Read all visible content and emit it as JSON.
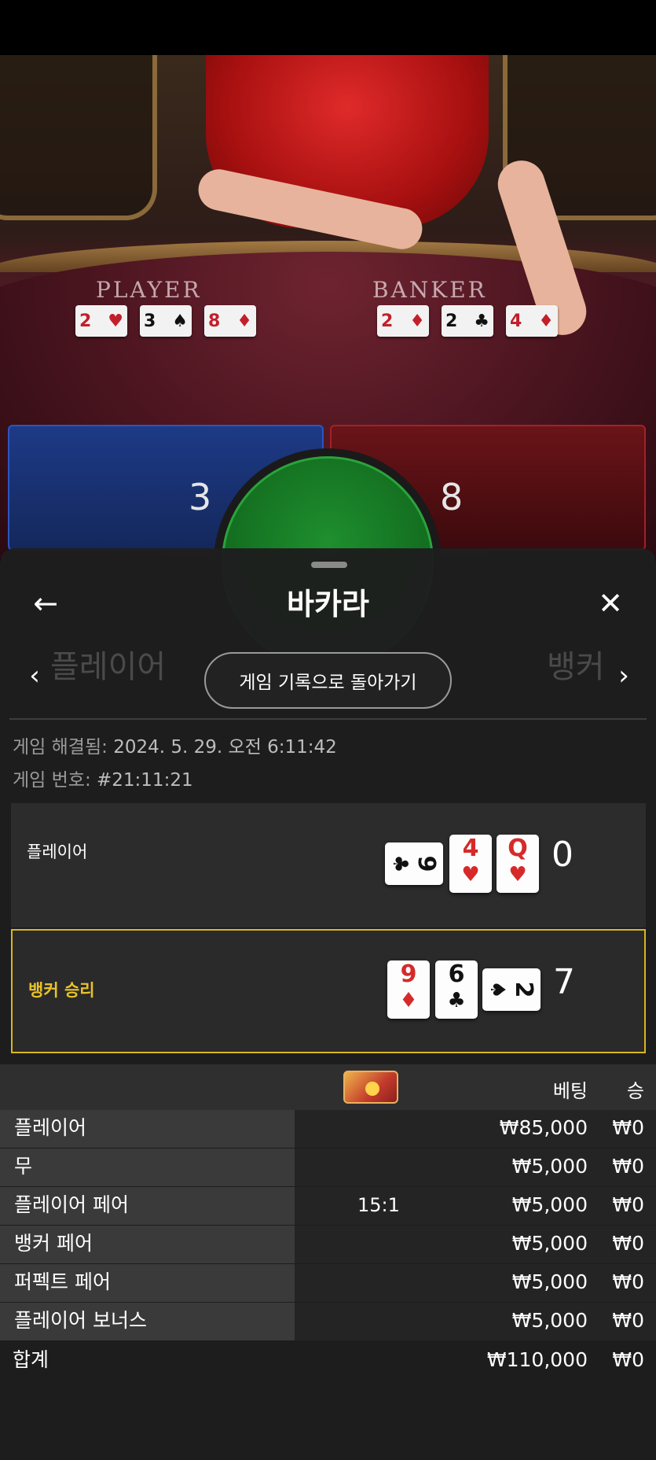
{
  "video": {
    "player_label": "PLAYER",
    "banker_label": "BANKER",
    "player_cards": [
      {
        "rank": "2",
        "suit": "♥",
        "color": "red"
      },
      {
        "rank": "3",
        "suit": "♠",
        "color": "black"
      },
      {
        "rank": "8",
        "suit": "♦",
        "color": "red"
      }
    ],
    "banker_cards": [
      {
        "rank": "2",
        "suit": "♦",
        "color": "red"
      },
      {
        "rank": "2",
        "suit": "♣",
        "color": "black"
      },
      {
        "rank": "4",
        "suit": "♦",
        "color": "red"
      }
    ]
  },
  "scores": {
    "player": "3",
    "banker": "8"
  },
  "sheet": {
    "title": "바카라",
    "back_to_history": "게임 기록으로 돌아가기",
    "resolved_label": "게임 해결됨:",
    "resolved_value": "2024. 5. 29. 오전 6:11:42",
    "game_no_label": "게임 번호:",
    "game_no_value": "#21:11:21"
  },
  "result": {
    "player": {
      "label": "플레이어",
      "total": "0",
      "cards": [
        {
          "rank": "9",
          "suit": "♣",
          "color": "black",
          "sideways": true
        },
        {
          "rank": "4",
          "suit": "♥",
          "color": "red",
          "sideways": false
        },
        {
          "rank": "Q",
          "suit": "♥",
          "color": "red",
          "sideways": false
        }
      ]
    },
    "banker": {
      "label": "뱅커 승리",
      "total": "7",
      "cards": [
        {
          "rank": "9",
          "suit": "♦",
          "color": "red",
          "sideways": false
        },
        {
          "rank": "6",
          "suit": "♣",
          "color": "black",
          "sideways": false
        },
        {
          "rank": "2",
          "suit": "♠",
          "color": "black",
          "sideways": true
        }
      ]
    }
  },
  "bets": {
    "badge_icon": "lightning-multiplier-badge-icon",
    "col_bet": "베팅",
    "col_win": "승",
    "rows": [
      {
        "name": "플레이어",
        "payout": "",
        "amount": "₩85,000",
        "win": "₩0"
      },
      {
        "name": "무",
        "payout": "",
        "amount": "₩5,000",
        "win": "₩0"
      },
      {
        "name": "플레이어 페어",
        "payout": "15:1",
        "amount": "₩5,000",
        "win": "₩0"
      },
      {
        "name": "뱅커 페어",
        "payout": "",
        "amount": "₩5,000",
        "win": "₩0"
      },
      {
        "name": "퍼펙트 페어",
        "payout": "",
        "amount": "₩5,000",
        "win": "₩0"
      },
      {
        "name": "플레이어 보너스",
        "payout": "",
        "amount": "₩5,000",
        "win": "₩0"
      }
    ],
    "total_label": "합계",
    "total_amount": "₩110,000",
    "total_win": "₩0"
  },
  "colors": {
    "player_blue": "#1d3a86",
    "banker_red": "#6a1418",
    "tie_green": "#1e8f2e",
    "winner_gold": "#d9b51f"
  }
}
